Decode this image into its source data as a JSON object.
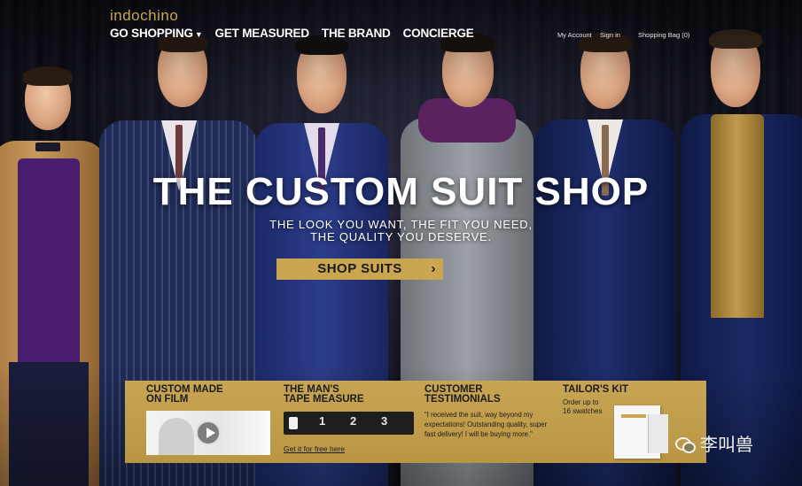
{
  "brand": {
    "logo_text": "indochino",
    "accent_color": "#c9a64f"
  },
  "nav": {
    "items": [
      {
        "label": "GO SHOPPING",
        "has_dropdown": true
      },
      {
        "label": "GET MEASURED"
      },
      {
        "label": "THE BRAND"
      },
      {
        "label": "CONCIERGE"
      }
    ],
    "dropdown_icon": "chevron-down-icon"
  },
  "account": {
    "my_account": "My Account",
    "sign_in": "Sign in",
    "shopping_bag": "Shopping Bag (0)"
  },
  "hero": {
    "title": "THE CUSTOM SUIT SHOP",
    "subtitle_line1": "THE LOOK YOU WANT, THE FIT YOU NEED,",
    "subtitle_line2": "THE QUALITY YOU DESERVE.",
    "cta_label": "SHOP SUITS",
    "cta_icon": "chevron-right-icon"
  },
  "promos": {
    "film": {
      "title_line1": "CUSTOM MADE",
      "title_line2": "ON FILM",
      "icon": "play-icon"
    },
    "tape": {
      "title_line1": "THE MAN'S",
      "title_line2": "TAPE MEASURE",
      "marks": [
        "1",
        "2",
        "3"
      ],
      "link": "Get it for free here"
    },
    "testimonials": {
      "title_line1": "CUSTOMER",
      "title_line2": "TESTIMONIALS",
      "quote": "\"I received the suit, way beyond my expectations! Outstanding quality, super fast delivery! I will be buying more.\""
    },
    "kit": {
      "title": "TAILOR'S KIT",
      "subtitle_line1": "Order up to",
      "subtitle_line2": "16 swatches"
    }
  },
  "watermark": {
    "text": "李叫兽",
    "icon": "wechat-icon"
  }
}
